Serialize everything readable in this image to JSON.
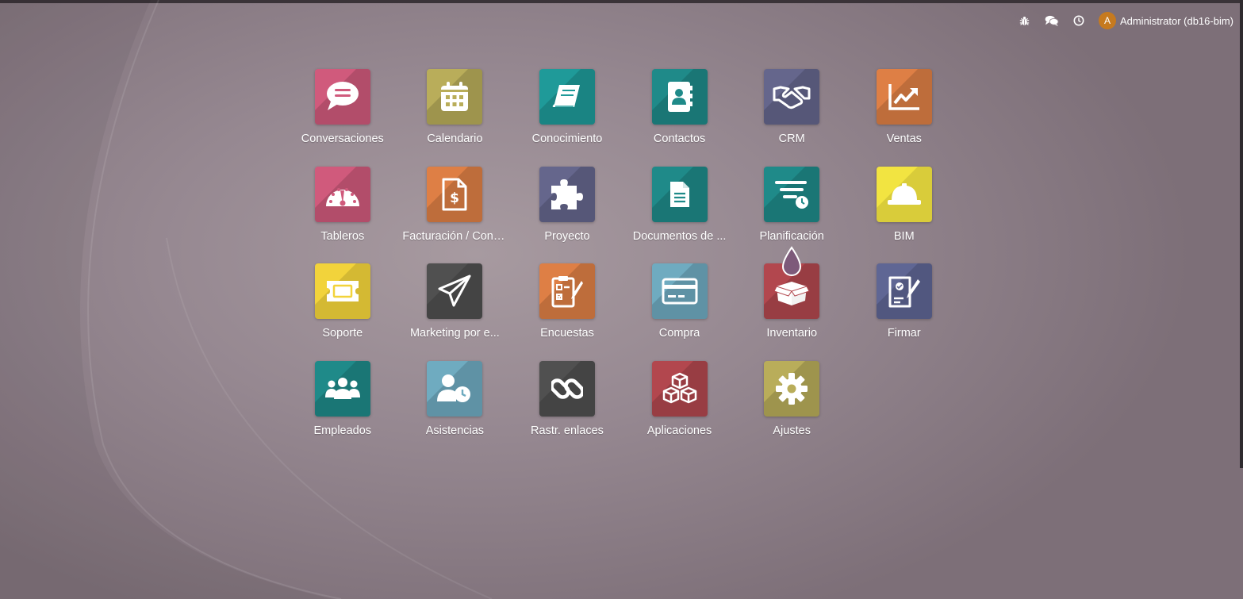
{
  "systray": {
    "user_initial": "A",
    "user_name": "Administrator (db16-bim)",
    "icons": [
      "bug-icon",
      "chat-icon",
      "clock-icon"
    ]
  },
  "colors": {
    "conversaciones": "#d05a7c",
    "calendario": "#b9ad5a",
    "conocimiento": "#1f9a99",
    "contactos": "#1f8a89",
    "crm": "#65668c",
    "ventas": "#de7f45",
    "tableros": "#d05a7c",
    "facturacion": "#de7f45",
    "proyecto": "#65668c",
    "documentos": "#1f8a89",
    "planificacion": "#1f8a89",
    "bim": "#f2e441",
    "soporte": "#f2d33b",
    "marketing": "#505050",
    "encuestas": "#de7f45",
    "compra": "#6fabc0",
    "inventario": "#b2474e",
    "firmar": "#5f6694",
    "empleados": "#1f8a89",
    "asistencias": "#6fabc0",
    "rastr": "#505050",
    "aplicaciones": "#b2474e",
    "ajustes": "#b9ad5a"
  },
  "apps": [
    {
      "label": "Conversaciones",
      "icon": "chat-bubble-icon"
    },
    {
      "label": "Calendario",
      "icon": "calendar-icon"
    },
    {
      "label": "Conocimiento",
      "icon": "book-icon"
    },
    {
      "label": "Contactos",
      "icon": "address-book-icon"
    },
    {
      "label": "CRM",
      "icon": "handshake-icon"
    },
    {
      "label": "Ventas",
      "icon": "trend-chart-icon"
    },
    {
      "label": "Tableros",
      "icon": "gauge-icon"
    },
    {
      "label": "Facturación / Contabilidad",
      "icon": "invoice-icon"
    },
    {
      "label": "Proyecto",
      "icon": "puzzle-icon"
    },
    {
      "label": "Documentos de ...",
      "icon": "document-icon"
    },
    {
      "label": "Planificación",
      "icon": "planning-icon"
    },
    {
      "label": "BIM",
      "icon": "hard-hat-icon"
    },
    {
      "label": "Soporte",
      "icon": "ticket-icon"
    },
    {
      "label": "Marketing por e...",
      "icon": "paper-plane-icon"
    },
    {
      "label": "Encuestas",
      "icon": "survey-icon"
    },
    {
      "label": "Compra",
      "icon": "credit-card-icon"
    },
    {
      "label": "Inventario",
      "icon": "box-icon"
    },
    {
      "label": "Firmar",
      "icon": "signature-icon"
    },
    {
      "label": "Empleados",
      "icon": "users-icon"
    },
    {
      "label": "Asistencias",
      "icon": "user-clock-icon"
    },
    {
      "label": "Rastr. enlaces",
      "icon": "link-icon"
    },
    {
      "label": "Aplicaciones",
      "icon": "cubes-icon"
    },
    {
      "label": "Ajustes",
      "icon": "gear-icon"
    }
  ]
}
